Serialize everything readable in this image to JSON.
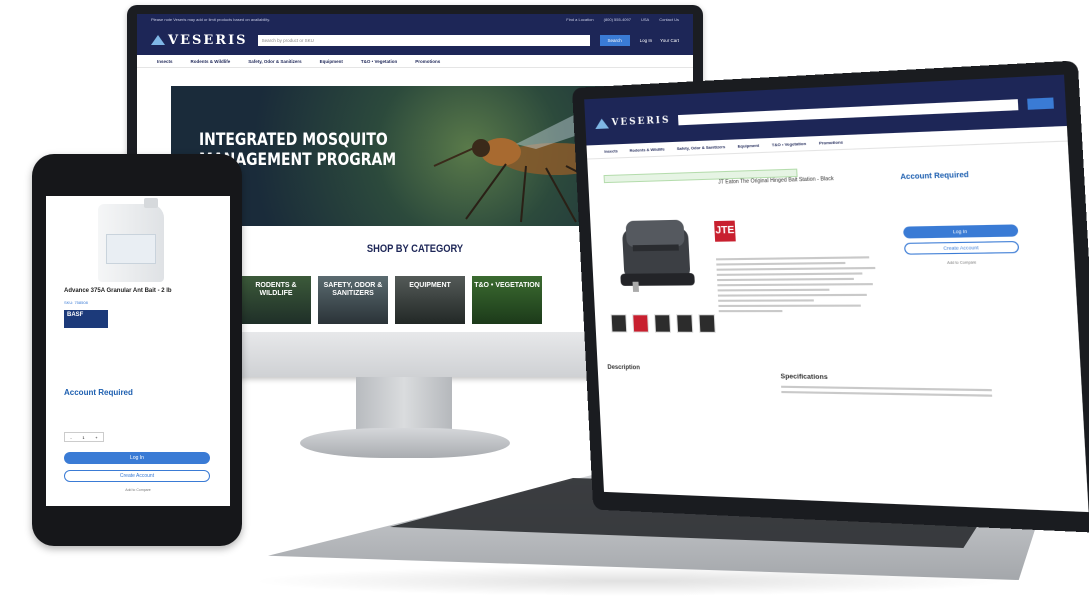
{
  "monitor": {
    "topbar_text": "Please note Veseris may add or limit products based on availability.",
    "find_location": "Find a Location",
    "phone": "(800) 555-4097",
    "flag_label": "USA",
    "contact": "Contact Us",
    "logo": "VESERIS",
    "search_placeholder": "Search by product or SKU",
    "search_button": "Search",
    "login": "Log In",
    "cart": "Your Cart",
    "nav": [
      "Insects",
      "Rodents & Wildlife",
      "Safety, Odor & Sanitizers",
      "Equipment",
      "T&O • Vegetation",
      "Promotions"
    ],
    "hero_title": "INTEGRATED MOSQUITO MANAGEMENT PROGRAM",
    "shop_title": "SHOP BY CATEGORY",
    "categories": [
      "RODENTS & WILDLIFE",
      "SAFETY, ODOR & SANITIZERS",
      "EQUIPMENT",
      "T&O • VEGETATION"
    ]
  },
  "laptop": {
    "logo": "VESERIS",
    "nav": [
      "Insects",
      "Rodents & Wildlife",
      "Safety, Odor & Sanitizers",
      "Equipment",
      "T&O • Vegetation",
      "Promotions"
    ],
    "product_title": "JT Eaton The Original Hinged Bait Station - Black",
    "brand_mark": "JTE",
    "account_required": "Account Required",
    "login_button": "Log In",
    "create_account": "Create Account",
    "add_to_compare": "Add to Compare",
    "description_heading": "Description",
    "specs_heading": "Specifications"
  },
  "phone": {
    "product_title": "Advance 375A Granular Ant Bait - 2 lb",
    "sku": "SKU: 758508",
    "brand": "BASF",
    "account_required": "Account Required",
    "qty": "1",
    "login_button": "Log In",
    "create_account": "Create Account",
    "add_to_compare": "Add to Compare"
  },
  "colors": {
    "navy": "#1d2657",
    "accent_blue": "#3a7bd5",
    "brand_red": "#c8202f"
  }
}
